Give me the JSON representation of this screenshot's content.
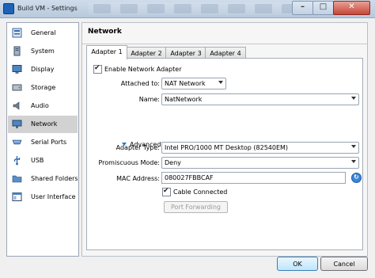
{
  "window": {
    "title": "Build VM - Settings",
    "close_label": "✕",
    "minimize_label": "–",
    "maximize_label": "□"
  },
  "sidebar": {
    "items": [
      {
        "label": "General",
        "icon": "general-icon",
        "selected": false
      },
      {
        "label": "System",
        "icon": "system-icon",
        "selected": false
      },
      {
        "label": "Display",
        "icon": "display-icon",
        "selected": false
      },
      {
        "label": "Storage",
        "icon": "storage-icon",
        "selected": false
      },
      {
        "label": "Audio",
        "icon": "audio-icon",
        "selected": false
      },
      {
        "label": "Network",
        "icon": "network-icon",
        "selected": true
      },
      {
        "label": "Serial Ports",
        "icon": "serial-ports-icon",
        "selected": false
      },
      {
        "label": "USB",
        "icon": "usb-icon",
        "selected": false
      },
      {
        "label": "Shared Folders",
        "icon": "shared-folders-icon",
        "selected": false
      },
      {
        "label": "User Interface",
        "icon": "user-interface-icon",
        "selected": false
      }
    ]
  },
  "panel": {
    "title": "Network",
    "tabs": [
      "Adapter 1",
      "Adapter 2",
      "Adapter 3",
      "Adapter 4"
    ],
    "active_tab": "Adapter 1"
  },
  "form": {
    "enable_adapter_label": "Enable Network Adapter",
    "enable_adapter_checked": true,
    "attached_to_label": "Attached to:",
    "attached_to_value": "NAT Network",
    "name_label": "Name:",
    "name_value": "NatNetwork",
    "advanced_label": "Advanced",
    "adapter_type_label": "Adapter Type:",
    "adapter_type_value": "Intel PRO/1000 MT Desktop (82540EM)",
    "promiscuous_label": "Promiscuous Mode:",
    "promiscuous_value": "Deny",
    "mac_label": "MAC Address:",
    "mac_value": "080027FBBCAF",
    "cable_connected_label": "Cable Connected",
    "cable_connected_checked": true,
    "port_forwarding_label": "Port Forwarding"
  },
  "buttons": {
    "ok": "OK",
    "cancel": "Cancel"
  },
  "colors": {
    "accent": "#1e7bc8",
    "selected_item": "#d2d2d2"
  }
}
